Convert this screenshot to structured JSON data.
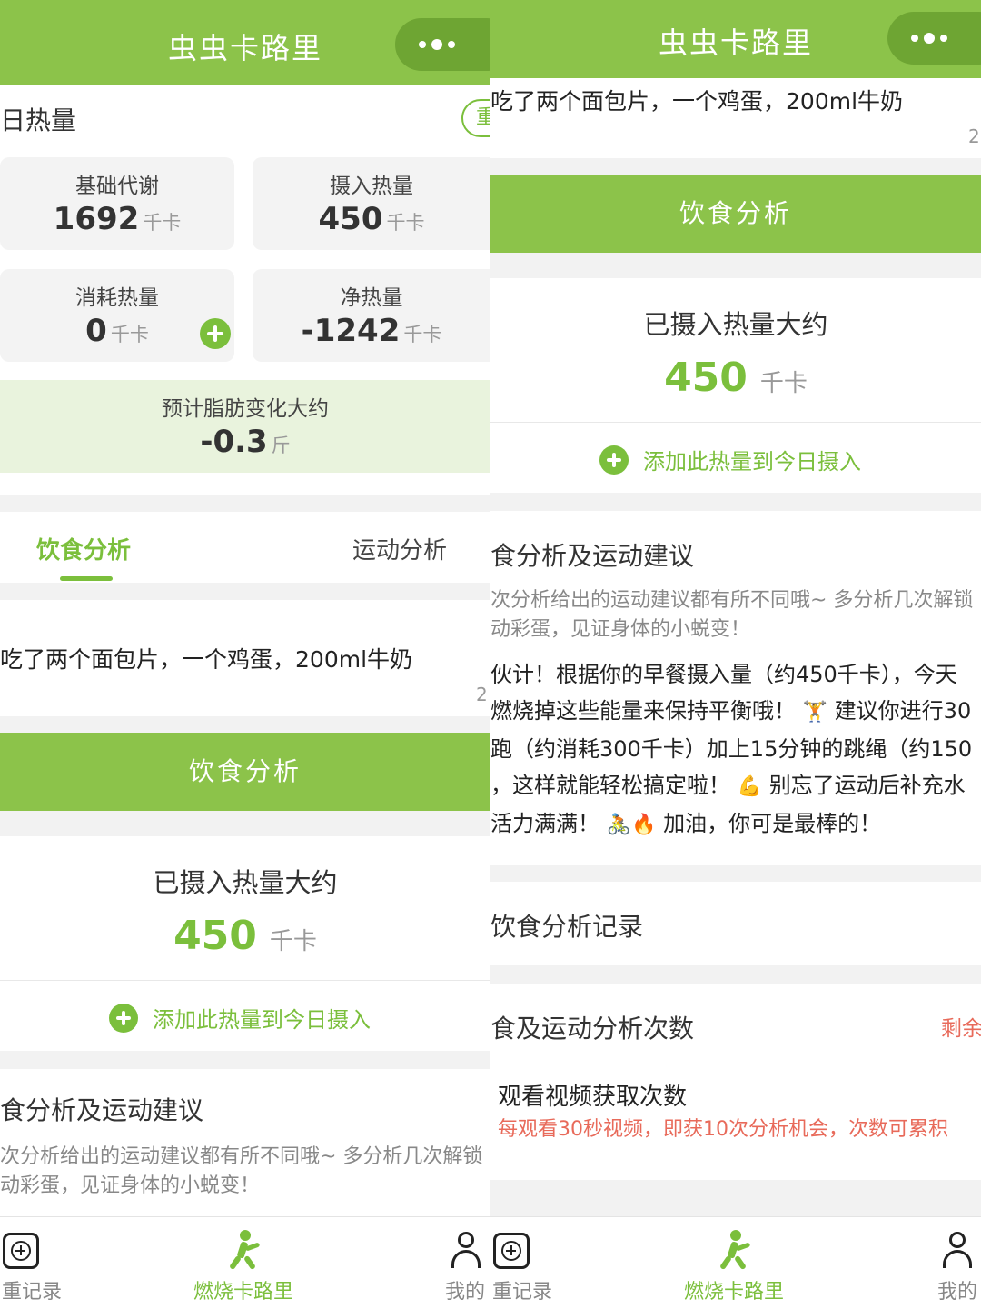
{
  "app": {
    "title": "虫虫卡路里",
    "more_icon": "more-dots-icon"
  },
  "colors": {
    "brand_green": "#8cc34a",
    "accent_green": "#7bbf3c",
    "warning_red": "#e86a5a"
  },
  "left": {
    "daily_title": "日热量",
    "reset_button_fragment": "重",
    "stats": {
      "bmr": {
        "label": "基础代谢",
        "value": "1692",
        "unit": "千卡"
      },
      "intake": {
        "label": "摄入热量",
        "value": "450",
        "unit": "千卡"
      },
      "burned": {
        "label": "消耗热量",
        "value": "0",
        "unit": "千卡"
      },
      "net": {
        "label": "净热量",
        "value": "-1242",
        "unit": "千卡"
      }
    },
    "fat_change": {
      "label": "预计脂肪变化大约",
      "value": "-0.3",
      "unit": "斤"
    },
    "tabs": [
      {
        "label": "饮食分析",
        "active": true
      },
      {
        "label": "运动分析",
        "active": false
      }
    ],
    "meal_input": "吃了两个面包片，一个鸡蛋，200ml牛奶",
    "char_counter_fragment": "2",
    "analyze_button": "饮食分析",
    "result": {
      "label": "已摄入热量大约",
      "value": "450",
      "unit": "千卡"
    },
    "add_intake": "添加此热量到今日摄入",
    "advice_title": "食分析及运动建议",
    "advice_hint_1": "次分析给出的运动建议都有所不同哦~ 多分析几次解锁",
    "advice_hint_2": "动彩蛋，见证身体的小蜕变！"
  },
  "right": {
    "meal_input": "吃了两个面包片，一个鸡蛋，200ml牛奶",
    "char_counter_fragment": "2",
    "analyze_button": "饮食分析",
    "result": {
      "label": "已摄入热量大约",
      "value": "450",
      "unit": "千卡"
    },
    "add_intake": "添加此热量到今日摄入",
    "advice_title": "食分析及运动建议",
    "advice_hint_1": "次分析给出的运动建议都有所不同哦~ 多分析几次解锁",
    "advice_hint_2": "动彩蛋，见证身体的小蜕变！",
    "advice_lines": [
      "伙计！根据你的早餐摄入量（约450千卡），今天",
      "燃烧掉这些能量来保持平衡哦！",
      "建议你进行30",
      "跑（约消耗300千卡）加上15分钟的跳绳（约150",
      "，这样就能轻松搞定啦！",
      "别忘了运动后补充水",
      "活力满满！",
      "加油，你可是最棒的！"
    ],
    "emojis": {
      "weightlifter": "🏋",
      "muscle": "💪",
      "cyclist": "🚴",
      "fire": "🔥"
    },
    "history": "饮食分析记录",
    "quota_title": "食及运动分析次数",
    "quota_remaining_fragment": "剩余",
    "video_title": "观看视频获取次数",
    "video_desc": "每观看30秒视频，即获10次分析机会，次数可累积"
  },
  "nav": {
    "left": {
      "record_fragment": "重记录",
      "burn": "燃烧卡路里",
      "mine_fragment": "我的"
    },
    "right": {
      "record_fragment": "重记录",
      "burn": "燃烧卡路里",
      "mine": "我的"
    },
    "icons": [
      "add-record-icon",
      "runner-icon",
      "profile-icon"
    ]
  }
}
